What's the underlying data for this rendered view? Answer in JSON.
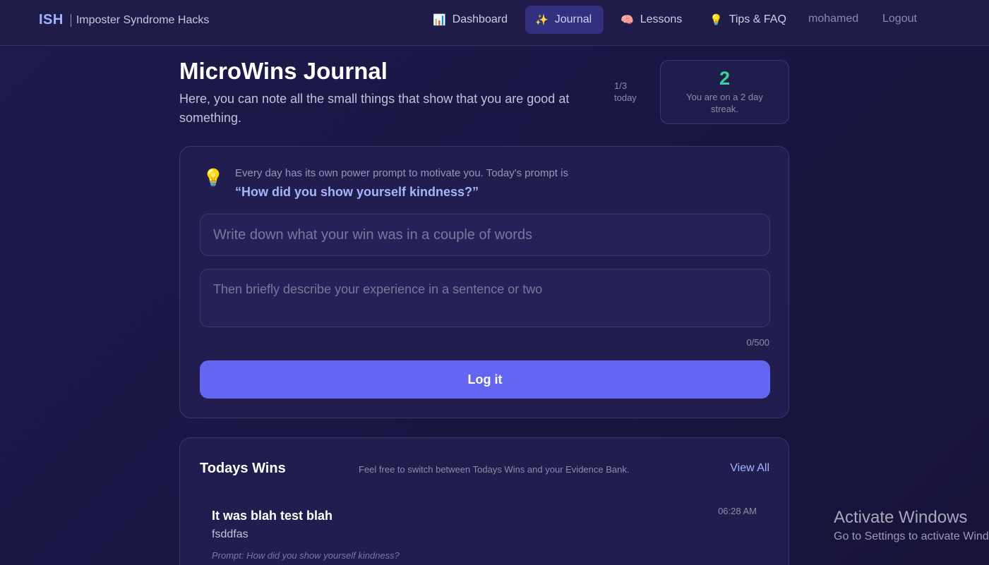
{
  "brand": {
    "logo": "ISH",
    "name": "Imposter Syndrome Hacks"
  },
  "nav": {
    "items": [
      {
        "icon": "📊",
        "label": "Dashboard"
      },
      {
        "icon": "✨",
        "label": "Journal"
      },
      {
        "icon": "🧠",
        "label": "Lessons"
      },
      {
        "icon": "💡",
        "label": "Tips & FAQ"
      }
    ],
    "active": "Journal",
    "user": "mohamed",
    "logout": "Logout"
  },
  "header": {
    "title": "MicroWins Journal",
    "subtitle": "Here, you can note all the small things that show that you are good at something.",
    "count_fraction": "1/3",
    "count_label": "today"
  },
  "streak": {
    "value": "2",
    "text": "You are on a 2 day streak."
  },
  "form": {
    "prompt_intro": "Every day has its own power prompt to motivate you. Today's prompt is",
    "prompt_text": "“How did you show yourself kindness?”",
    "title_placeholder": "Write down what your win was in a couple of words",
    "desc_placeholder": "Then briefly describe your experience in a sentence or two",
    "char_count": "0/500",
    "submit_label": "Log it"
  },
  "wins": {
    "title": "Todays Wins",
    "hint": "Feel free to switch between Todays Wins and your Evidence Bank.",
    "view_all": "View All",
    "items": [
      {
        "title": "It was blah test blah",
        "time": "06:28 AM",
        "description": "fsddfas",
        "prompt": "Prompt: How did you show yourself kindness?"
      }
    ]
  },
  "watermark": {
    "title": "Activate Windows",
    "subtitle": "Go to Settings to activate Windows."
  },
  "colors": {
    "accent": "#6366f1",
    "streak": "#34d399",
    "link": "#a5b4fc"
  }
}
